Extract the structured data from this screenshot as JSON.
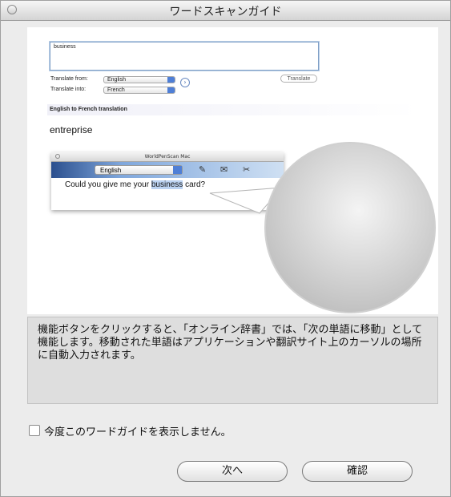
{
  "window": {
    "title": "ワードスキャンガイド"
  },
  "illustration": {
    "input_value": "business",
    "translate_from_label": "Translate from:",
    "translate_from_value": "English",
    "translate_into_label": "Translate into:",
    "translate_into_value": "French",
    "translate_button": "Translate",
    "section_header": "English to French translation",
    "result_text": "entreprise",
    "wps_window_title": "WorldPenScan Mac",
    "wps_language": "English",
    "scan_text_before": "Could you give me your ",
    "scan_text_highlight": "business",
    "scan_text_after": " card?"
  },
  "description": "機能ボタンをクリックすると、「オンライン辞書」では、「次の単語に移動」として機能します。移動された単語はアプリケーションや翻訳サイト上のカーソルの場所に自動入力されます。",
  "checkbox_label": "今度このワードガイドを表示しません。",
  "buttons": {
    "next": "次へ",
    "confirm": "確認"
  }
}
